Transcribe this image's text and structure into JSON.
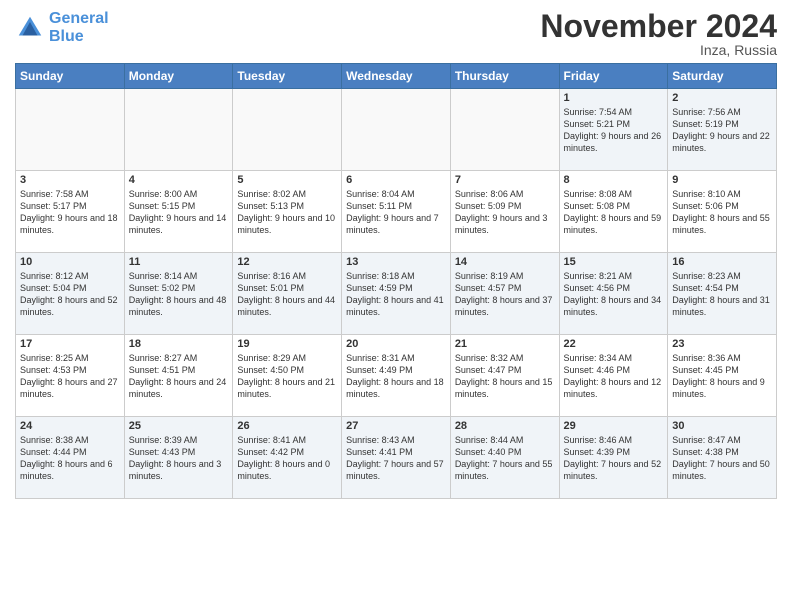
{
  "header": {
    "logo_line1": "General",
    "logo_line2": "Blue",
    "month_title": "November 2024",
    "location": "Inza, Russia"
  },
  "weekdays": [
    "Sunday",
    "Monday",
    "Tuesday",
    "Wednesday",
    "Thursday",
    "Friday",
    "Saturday"
  ],
  "weeks": [
    [
      {
        "day": "",
        "info": ""
      },
      {
        "day": "",
        "info": ""
      },
      {
        "day": "",
        "info": ""
      },
      {
        "day": "",
        "info": ""
      },
      {
        "day": "",
        "info": ""
      },
      {
        "day": "1",
        "info": "Sunrise: 7:54 AM\nSunset: 5:21 PM\nDaylight: 9 hours and 26 minutes."
      },
      {
        "day": "2",
        "info": "Sunrise: 7:56 AM\nSunset: 5:19 PM\nDaylight: 9 hours and 22 minutes."
      }
    ],
    [
      {
        "day": "3",
        "info": "Sunrise: 7:58 AM\nSunset: 5:17 PM\nDaylight: 9 hours and 18 minutes."
      },
      {
        "day": "4",
        "info": "Sunrise: 8:00 AM\nSunset: 5:15 PM\nDaylight: 9 hours and 14 minutes."
      },
      {
        "day": "5",
        "info": "Sunrise: 8:02 AM\nSunset: 5:13 PM\nDaylight: 9 hours and 10 minutes."
      },
      {
        "day": "6",
        "info": "Sunrise: 8:04 AM\nSunset: 5:11 PM\nDaylight: 9 hours and 7 minutes."
      },
      {
        "day": "7",
        "info": "Sunrise: 8:06 AM\nSunset: 5:09 PM\nDaylight: 9 hours and 3 minutes."
      },
      {
        "day": "8",
        "info": "Sunrise: 8:08 AM\nSunset: 5:08 PM\nDaylight: 8 hours and 59 minutes."
      },
      {
        "day": "9",
        "info": "Sunrise: 8:10 AM\nSunset: 5:06 PM\nDaylight: 8 hours and 55 minutes."
      }
    ],
    [
      {
        "day": "10",
        "info": "Sunrise: 8:12 AM\nSunset: 5:04 PM\nDaylight: 8 hours and 52 minutes."
      },
      {
        "day": "11",
        "info": "Sunrise: 8:14 AM\nSunset: 5:02 PM\nDaylight: 8 hours and 48 minutes."
      },
      {
        "day": "12",
        "info": "Sunrise: 8:16 AM\nSunset: 5:01 PM\nDaylight: 8 hours and 44 minutes."
      },
      {
        "day": "13",
        "info": "Sunrise: 8:18 AM\nSunset: 4:59 PM\nDaylight: 8 hours and 41 minutes."
      },
      {
        "day": "14",
        "info": "Sunrise: 8:19 AM\nSunset: 4:57 PM\nDaylight: 8 hours and 37 minutes."
      },
      {
        "day": "15",
        "info": "Sunrise: 8:21 AM\nSunset: 4:56 PM\nDaylight: 8 hours and 34 minutes."
      },
      {
        "day": "16",
        "info": "Sunrise: 8:23 AM\nSunset: 4:54 PM\nDaylight: 8 hours and 31 minutes."
      }
    ],
    [
      {
        "day": "17",
        "info": "Sunrise: 8:25 AM\nSunset: 4:53 PM\nDaylight: 8 hours and 27 minutes."
      },
      {
        "day": "18",
        "info": "Sunrise: 8:27 AM\nSunset: 4:51 PM\nDaylight: 8 hours and 24 minutes."
      },
      {
        "day": "19",
        "info": "Sunrise: 8:29 AM\nSunset: 4:50 PM\nDaylight: 8 hours and 21 minutes."
      },
      {
        "day": "20",
        "info": "Sunrise: 8:31 AM\nSunset: 4:49 PM\nDaylight: 8 hours and 18 minutes."
      },
      {
        "day": "21",
        "info": "Sunrise: 8:32 AM\nSunset: 4:47 PM\nDaylight: 8 hours and 15 minutes."
      },
      {
        "day": "22",
        "info": "Sunrise: 8:34 AM\nSunset: 4:46 PM\nDaylight: 8 hours and 12 minutes."
      },
      {
        "day": "23",
        "info": "Sunrise: 8:36 AM\nSunset: 4:45 PM\nDaylight: 8 hours and 9 minutes."
      }
    ],
    [
      {
        "day": "24",
        "info": "Sunrise: 8:38 AM\nSunset: 4:44 PM\nDaylight: 8 hours and 6 minutes."
      },
      {
        "day": "25",
        "info": "Sunrise: 8:39 AM\nSunset: 4:43 PM\nDaylight: 8 hours and 3 minutes."
      },
      {
        "day": "26",
        "info": "Sunrise: 8:41 AM\nSunset: 4:42 PM\nDaylight: 8 hours and 0 minutes."
      },
      {
        "day": "27",
        "info": "Sunrise: 8:43 AM\nSunset: 4:41 PM\nDaylight: 7 hours and 57 minutes."
      },
      {
        "day": "28",
        "info": "Sunrise: 8:44 AM\nSunset: 4:40 PM\nDaylight: 7 hours and 55 minutes."
      },
      {
        "day": "29",
        "info": "Sunrise: 8:46 AM\nSunset: 4:39 PM\nDaylight: 7 hours and 52 minutes."
      },
      {
        "day": "30",
        "info": "Sunrise: 8:47 AM\nSunset: 4:38 PM\nDaylight: 7 hours and 50 minutes."
      }
    ]
  ]
}
